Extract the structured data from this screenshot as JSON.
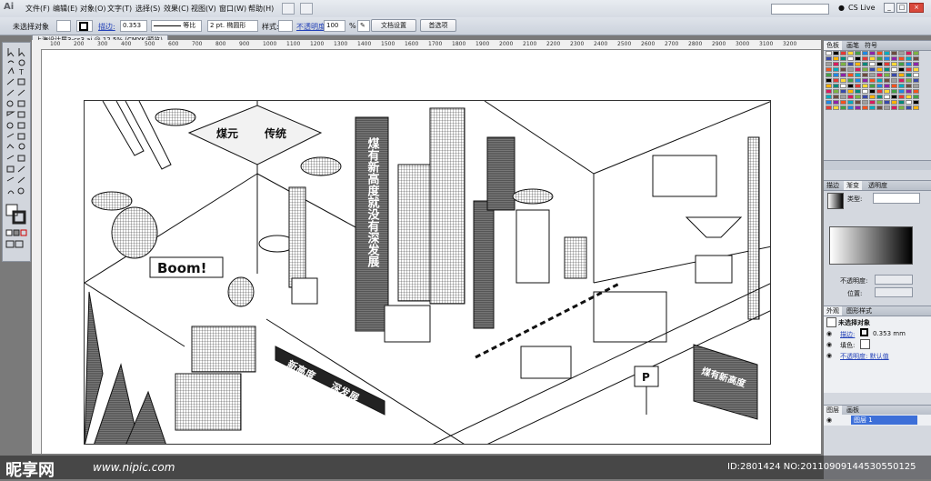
{
  "app": {
    "logo": "Ai",
    "menu": [
      "文件(F)",
      "编辑(E)",
      "对象(O)",
      "文字(T)",
      "选择(S)",
      "效果(C)",
      "视图(V)",
      "窗口(W)",
      "帮助(H)"
    ],
    "cs_live": "CS Live",
    "window_controls": [
      "_",
      "□",
      "×"
    ]
  },
  "control_bar": {
    "no_selection": "未选择对象",
    "stroke_label": "描边:",
    "stroke_value": "0.353",
    "profile": "等比",
    "brush": "2 pt. 椭圆形",
    "style_label": "样式:",
    "opacity_label": "不透明度:",
    "opacity_value": "100",
    "percent": "%",
    "doc_setup_button": "文档设置",
    "preferences_button": "首选项"
  },
  "document": {
    "tab_title": "上海设计展3-cs3.ai @ 12.5% (CMYK/预览)",
    "ruler_ticks": [
      "100",
      "200",
      "300",
      "400",
      "500",
      "600",
      "700",
      "800",
      "900",
      "1000",
      "1100",
      "1200",
      "1300",
      "1400",
      "1500",
      "1600",
      "1700",
      "1800",
      "1900",
      "2000",
      "2100",
      "2200",
      "2300",
      "2400",
      "2500",
      "2600",
      "2700",
      "2800",
      "2900",
      "3000",
      "3100",
      "3200"
    ]
  },
  "artwork": {
    "roof_labels": [
      "煤元",
      "传统"
    ],
    "tower_text": "煤有新高度就没有深发展",
    "boom": "Boom!",
    "slogan_1": "新高度",
    "slogan_2": "深发展",
    "sign_right": "煤有新高度",
    "parking": "P"
  },
  "panels": {
    "swatch_tabs": [
      "色板",
      "画笔",
      "符号"
    ],
    "gradient_tabs": [
      "描边",
      "渐变",
      "透明度"
    ],
    "gradient_type_label": "类型:",
    "opacity_label": "不透明度:",
    "location_label": "位置:",
    "appearance_tabs": [
      "外观",
      "图形样式"
    ],
    "appearance_title": "未选择对象",
    "appearance_stroke": "描边:",
    "appearance_stroke_value": "0.353 mm",
    "appearance_fill": "填色:",
    "appearance_opacity": "不透明度: 默认值",
    "layers_tabs": [
      "图层",
      "画板"
    ],
    "layer_name": "图层 1"
  },
  "watermark": {
    "logo": "昵享网",
    "url": "www.nipic.com",
    "id_text": "ID:2801424 NO:20110909144530550125"
  },
  "colors": {
    "accent": "#2442b8",
    "selected_layer": "#3d6fd8"
  }
}
